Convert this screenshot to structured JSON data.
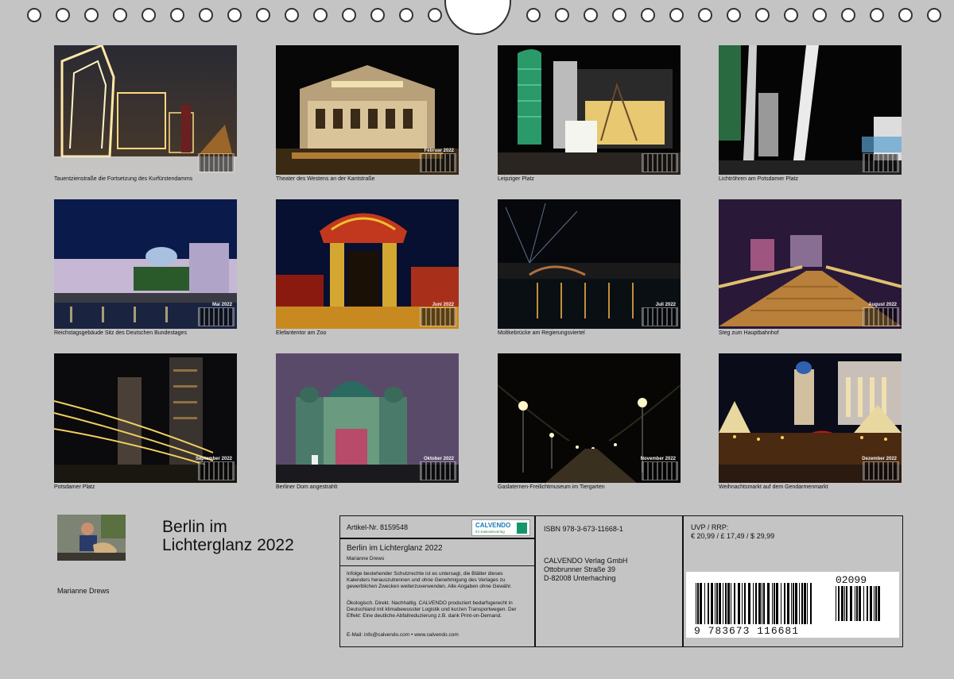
{
  "calendar": {
    "title_line1": "Berlin im",
    "title_line2": "Lichterglanz 2022",
    "author": "Marianne Drews"
  },
  "thumbnails": [
    {
      "caption": "Tauentzienstraße die Fortsetzung des Kurfürstendamms",
      "month": ""
    },
    {
      "caption": "Theater des Westens an der Kantstraße",
      "month": "Februar 2022"
    },
    {
      "caption": "Leipziger Platz",
      "month": ""
    },
    {
      "caption": "Lichtröhren am Potsdamer Platz",
      "month": ""
    },
    {
      "caption": "Reichstagsgebäude Sitz des Deutschen Bundestages",
      "month": "Mai 2022"
    },
    {
      "caption": "Elefantentor am Zoo",
      "month": "Juni 2022"
    },
    {
      "caption": "Moltkebrücke am Regierungsviertel",
      "month": "Juli 2022"
    },
    {
      "caption": "Steg zum Hauptbahnhof",
      "month": "August 2022"
    },
    {
      "caption": "Potsdamer Platz",
      "month": "September 2022"
    },
    {
      "caption": "Berliner Dom angestrahlt",
      "month": "Oktober 2022"
    },
    {
      "caption": "Gaslaternen-Freilichtmuseum im Tiergarten",
      "month": "November 2022"
    },
    {
      "caption": "Weihnachtsmarkt auf dem Gendarmenmarkt",
      "month": "Dezember 2022"
    }
  ],
  "info": {
    "article": "Artikel-Nr. 8159548",
    "logo_text": "CALVENDO",
    "logo_sub": "Ihr Kalenderverlag",
    "product_title": "Berlin im Lichterglanz 2022",
    "product_author": "Marianne Drews",
    "legal_text": "Infolge bestehender Schutzrechte ist es untersagt, die Blätter dieses Kalenders herauszutrennen und ohne Genehmigung des Verlages zu gewerblichen Zwecken weiterzuverwenden. Alle Angaben ohne Gewähr.",
    "eco_text": "Ökologisch. Direkt. Nachhaltig. CALVENDO produziert bedarfsgerecht in Deutschland mit klimabewusster Logistik und kurzen Transportwegen. Der Effekt: Eine deutliche Abfallreduzierung z.B. dank Print-on-Demand.",
    "contact": "E-Mail: info@calvendo.com • www.calvendo.com",
    "isbn": "ISBN 978-3-673-11668-1",
    "publisher_name": "CALVENDO Verlag GmbH",
    "publisher_street": "Ottobrunner Straße 39",
    "publisher_city": "D-82008 Unterhaching",
    "price_label": "UVP / RRP:",
    "price_values": "€ 20,99 / £ 17,49 / $ 29,99",
    "ean": "9 783673 116681",
    "ean_addon": "02099"
  }
}
